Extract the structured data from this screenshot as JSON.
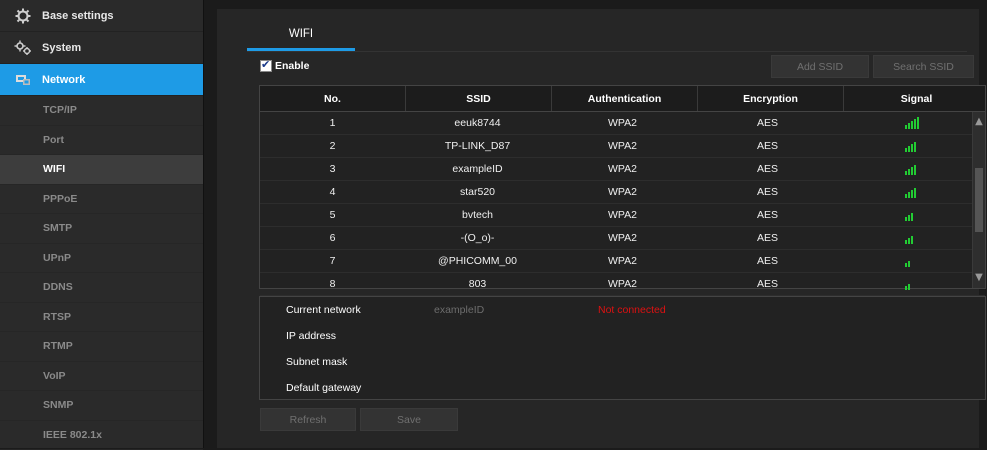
{
  "sidebar": {
    "main_items": [
      {
        "label": "Base settings"
      },
      {
        "label": "System"
      },
      {
        "label": "Network"
      }
    ],
    "sub_items": [
      {
        "label": "TCP/IP"
      },
      {
        "label": "Port"
      },
      {
        "label": "WIFI"
      },
      {
        "label": "PPPoE"
      },
      {
        "label": "SMTP"
      },
      {
        "label": "UPnP"
      },
      {
        "label": "DDNS"
      },
      {
        "label": "RTSP"
      },
      {
        "label": "RTMP"
      },
      {
        "label": "VoIP"
      },
      {
        "label": "SNMP"
      },
      {
        "label": "IEEE 802.1x"
      }
    ],
    "active_main": "Network",
    "active_sub": "WIFI"
  },
  "tab": {
    "label": "WIFI"
  },
  "enable": {
    "label": "Enable",
    "checked": true
  },
  "buttons": {
    "add_ssid": "Add SSID",
    "search_ssid": "Search SSID",
    "refresh": "Refresh",
    "save": "Save"
  },
  "table": {
    "headers": [
      "No.",
      "SSID",
      "Authentication",
      "Encryption",
      "Signal"
    ],
    "rows": [
      {
        "no": "1",
        "ssid": "eeuk8744",
        "auth": "WPA2",
        "enc": "AES",
        "signal": 5
      },
      {
        "no": "2",
        "ssid": "TP-LINK_D87",
        "auth": "WPA2",
        "enc": "AES",
        "signal": 4
      },
      {
        "no": "3",
        "ssid": "exampleID",
        "auth": "WPA2",
        "enc": "AES",
        "signal": 4
      },
      {
        "no": "4",
        "ssid": "star520",
        "auth": "WPA2",
        "enc": "AES",
        "signal": 4
      },
      {
        "no": "5",
        "ssid": "bvtech",
        "auth": "WPA2",
        "enc": "AES",
        "signal": 3
      },
      {
        "no": "6",
        "ssid": "-(O_o)-",
        "auth": "WPA2",
        "enc": "AES",
        "signal": 3
      },
      {
        "no": "7",
        "ssid": "@PHICOMM_00",
        "auth": "WPA2",
        "enc": "AES",
        "signal": 2
      },
      {
        "no": "8",
        "ssid": "803",
        "auth": "WPA2",
        "enc": "AES",
        "signal": 2
      }
    ]
  },
  "info": {
    "current_network_label": "Current network",
    "current_network_value": "exampleID",
    "status": "Not connected",
    "ip_label": "IP address",
    "mask_label": "Subnet mask",
    "gateway_label": "Default gateway"
  },
  "colors": {
    "accent": "#1e9be6",
    "signal": "#22cc33",
    "error": "#dd1111"
  }
}
